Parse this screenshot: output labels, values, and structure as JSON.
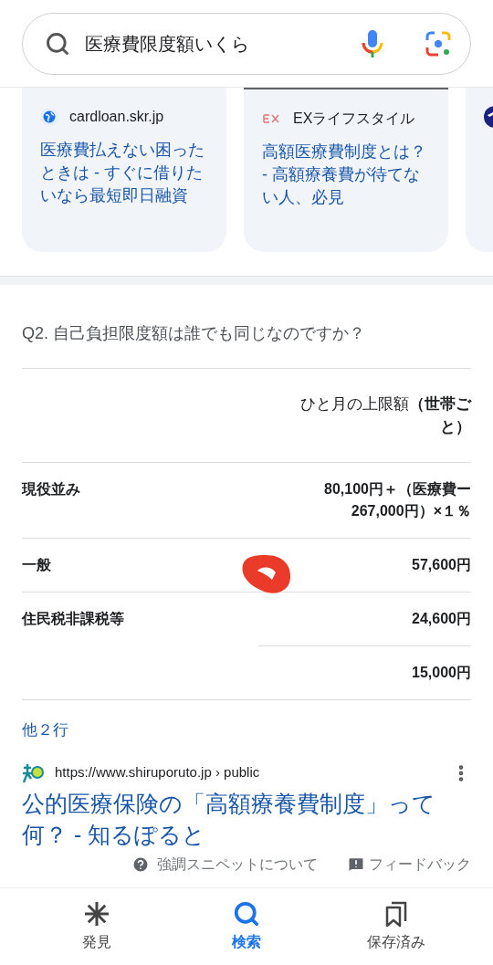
{
  "search": {
    "value": "医療費限度額いくら"
  },
  "cards": [
    {
      "kind": "globe",
      "source": "cardloan.skr.jp",
      "title": "医療費払えない困ったときは - すぐに借りたいなら最短即日融資",
      "loading": false
    },
    {
      "kind": "logo",
      "source": "EXライフスタイル",
      "title": "高額医療費制度とは？ - 高額療養費が待てない人、必見",
      "loading": true
    },
    {
      "kind": "partial"
    }
  ],
  "snippet": {
    "question": "Q2. 自己負担限度額は誰でも同じなのですか？",
    "header": "ひと月の上限額**（世帯ごと）**",
    "rows": [
      {
        "label": "現役並み",
        "value": "80,100円＋（医療費ー267,000円）×１％"
      },
      {
        "label": "一般",
        "value": "57,600円"
      },
      {
        "label": "住民税非課税等",
        "value": "24,600円"
      },
      {
        "value": "15,000円"
      }
    ],
    "more_rows": "他２行"
  },
  "result": {
    "url": "https://www.shiruporuto.jp › public",
    "title": "公的医療保険の「高額療養費制度」って何？ - 知るぽると"
  },
  "footer": {
    "about": "強調スニペットについて",
    "feedback": "フィードバック"
  },
  "nav": [
    {
      "kind": "discover",
      "label": "発見",
      "selected": false
    },
    {
      "kind": "search",
      "label": "検索",
      "selected": true
    },
    {
      "kind": "saved",
      "label": "保存済み",
      "selected": false
    }
  ]
}
